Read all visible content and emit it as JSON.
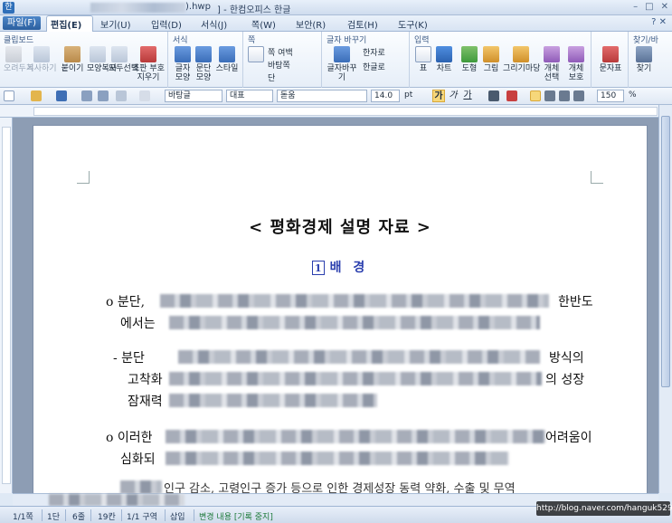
{
  "window": {
    "title": "] - 한컴오피스 한글",
    "file_suffix": ").hwp",
    "controls": [
      "–",
      "□",
      "✕"
    ]
  },
  "menu": {
    "file": "파일(F)",
    "items": [
      "편집(E)",
      "보기(U)",
      "입력(D)",
      "서식(J)",
      "쪽(W)",
      "보안(R)",
      "검토(H)",
      "도구(K)"
    ],
    "help": "? ✕"
  },
  "ribbon": {
    "clipboard": {
      "title": "클립보드",
      "buttons": [
        "오려두기",
        "복사하기",
        "붙이기",
        "모양복사",
        "모두선택",
        "조판 부호지우기"
      ]
    },
    "format": {
      "title": "서식",
      "buttons": [
        "글자모양",
        "문단모양",
        "스타일"
      ]
    },
    "page": {
      "title": "쪽",
      "buttons": [
        "쪽 여백",
        "바탕쪽",
        "단"
      ]
    },
    "char_change": {
      "title": "글자 바꾸기",
      "buttons": [
        "글자바꾸기",
        "한자로",
        "한글로"
      ]
    },
    "insert": {
      "title": "입력",
      "buttons": [
        "표",
        "차트",
        "도형",
        "그림",
        "그리기마당",
        "개체 선택",
        "개체 보호"
      ]
    },
    "symbol": {
      "buttons": [
        "문자표"
      ]
    },
    "find": {
      "title": "찾기/바",
      "buttons": [
        "찾기"
      ]
    }
  },
  "format_bar": {
    "style": "바탕글",
    "para": "대표",
    "font": "돋움",
    "size": "14.0",
    "unit": "pt",
    "bold": "가",
    "italic": "가",
    "underline": "가",
    "zoom": "150",
    "zoom_unit": "%"
  },
  "document": {
    "title": "< 평화경제 설명 자료 >",
    "section_marker": "1",
    "section_title": "배  경",
    "lines": [
      {
        "prefix": "o 분단, ",
        "suffix": "한반도"
      },
      {
        "prefix": "에서는",
        "suffix": ""
      },
      {
        "prefix": "- 분단",
        "suffix": "방식의"
      },
      {
        "prefix": "고착화",
        "suffix": "의 성장"
      },
      {
        "prefix": "잠재력",
        "suffix": ""
      },
      {
        "prefix": "o 이러한",
        "suffix": "어려움이"
      },
      {
        "prefix": "심화되",
        "suffix": ""
      },
      {
        "prefix": "",
        "suffix": "인구 감소, 고령인구 증가 등으로 인한 경제성장 동력 약화, 수출 및 무역"
      }
    ]
  },
  "status": {
    "page": "1/1쪽",
    "column": "1단",
    "row": "6줄",
    "col": "19칸",
    "section": "1/1 구역",
    "mode": "삽입",
    "track": "변경 내용 [기록 중지]"
  },
  "watermark": "http://blog.naver.com/hanguk529"
}
